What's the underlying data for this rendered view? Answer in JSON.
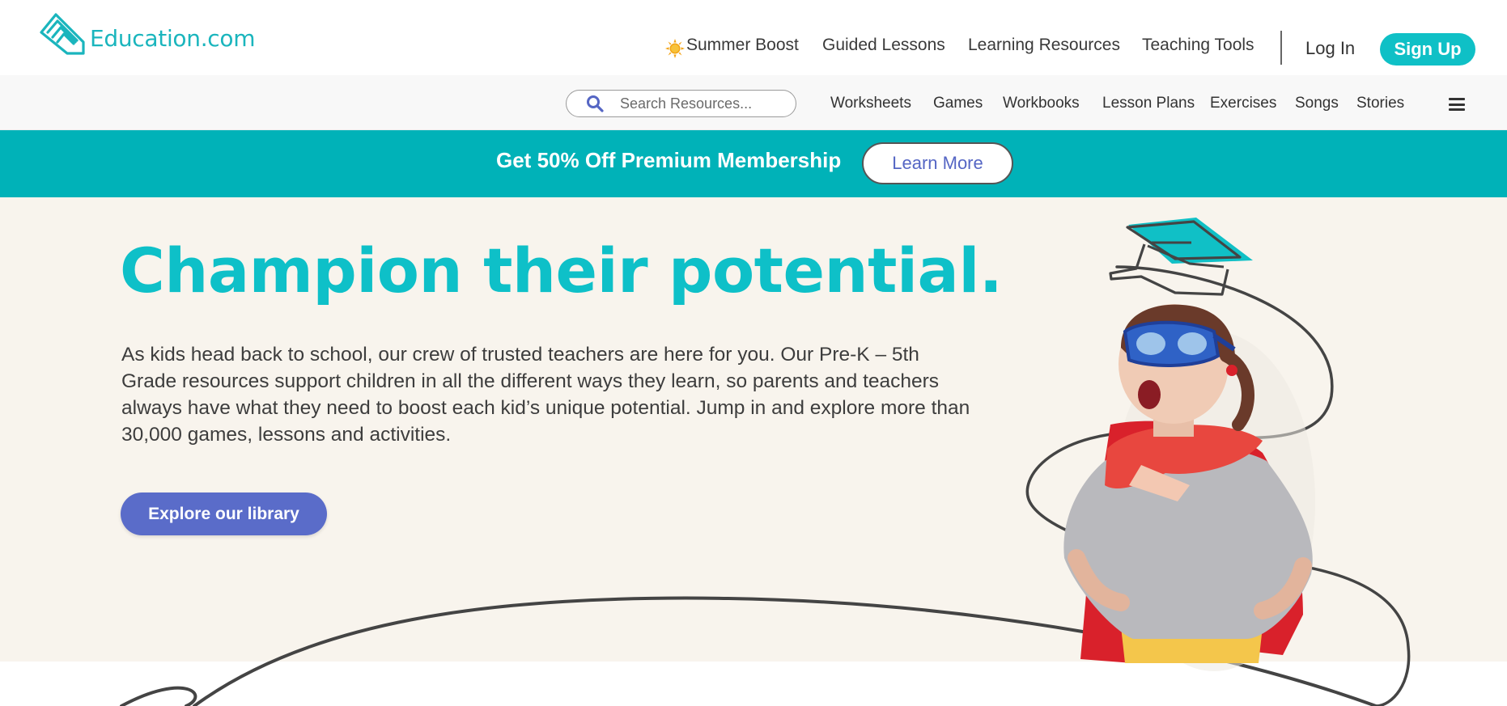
{
  "brand": {
    "name": "Education.com",
    "accent": "#0fc0c6",
    "secondary": "#5a6cc9",
    "hero_bg": "#f8f4ed",
    "banner_bg": "#00b2b8"
  },
  "header": {
    "nav": [
      {
        "label": "Summer Boost",
        "icon": "sun-icon"
      },
      {
        "label": "Guided Lessons"
      },
      {
        "label": "Learning Resources"
      },
      {
        "label": "Teaching Tools"
      }
    ],
    "login_label": "Log In",
    "signup_label": "Sign Up"
  },
  "subnav": {
    "search_placeholder": "Search Resources...",
    "search_icon": "search-icon",
    "items": [
      "Worksheets",
      "Games",
      "Workbooks",
      "Lesson Plans",
      "Exercises",
      "Songs",
      "Stories"
    ],
    "menu_icon": "hamburger-menu-icon"
  },
  "promo": {
    "text": "Get 50% Off Premium Membership",
    "button_label": "Learn More"
  },
  "hero": {
    "title": "Champion their potential.",
    "body": "As kids head back to school, our crew of trusted teachers are here for you. Our Pre-K – 5th Grade resources support children in all the different ways they learn, so parents and teachers always have what they need to boost each kid’s unique potential. Jump in and explore more than 30,000 games, lessons and activities.",
    "cta_label": "Explore our library",
    "illustration": "graduation-cap-icon"
  }
}
